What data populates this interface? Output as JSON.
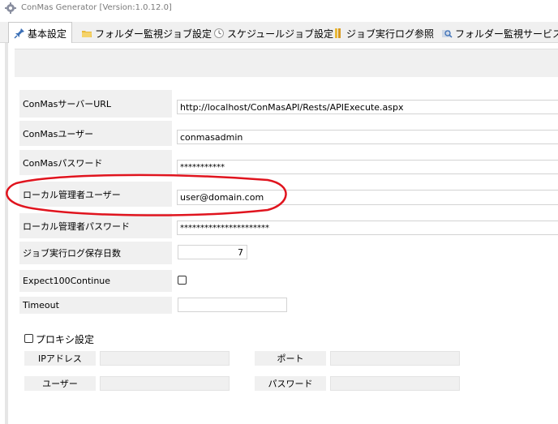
{
  "window": {
    "title": "ConMas Generator [Version:1.0.12.0]",
    "app_icon": "gear-icon"
  },
  "tabs": [
    {
      "label": "基本設定",
      "icon": "pin-icon",
      "active": true
    },
    {
      "label": "フォルダー監視ジョブ設定",
      "icon": "folder-icon",
      "active": false
    },
    {
      "label": "スケジュールジョブ設定",
      "icon": "clock-icon",
      "active": false
    },
    {
      "label": "ジョブ実行ログ参照",
      "icon": "log-icon",
      "active": false
    },
    {
      "label": "フォルダー監視サービス操",
      "icon": "search-icon",
      "active": false
    }
  ],
  "settings": {
    "server_url": {
      "label": "ConMasサーバーURL",
      "value": "http://localhost/ConMasAPI/Rests/APIExecute.aspx"
    },
    "user": {
      "label": "ConMasユーザー",
      "value": "conmasadmin"
    },
    "password": {
      "label": "ConMasパスワード",
      "value": "***********"
    },
    "local_admin_user": {
      "label": "ローカル管理者ユーザー",
      "value": "user@domain.com"
    },
    "local_admin_password": {
      "label": "ローカル管理者パスワード",
      "value": "**********************"
    },
    "log_retention_days": {
      "label": "ジョブ実行ログ保存日数",
      "value": "7"
    },
    "expect100continue": {
      "label": "Expect100Continue",
      "checked": false
    },
    "timeout": {
      "label": "Timeout",
      "value": ""
    }
  },
  "proxy": {
    "checkbox_label": "プロキシ設定",
    "checked": false,
    "ip_label": "IPアドレス",
    "port_label": "ポート",
    "user_label": "ユーザー",
    "password_label": "パスワード"
  },
  "colors": {
    "annotation_red": "#e0141e",
    "panel_gray": "#f0f0f0"
  }
}
